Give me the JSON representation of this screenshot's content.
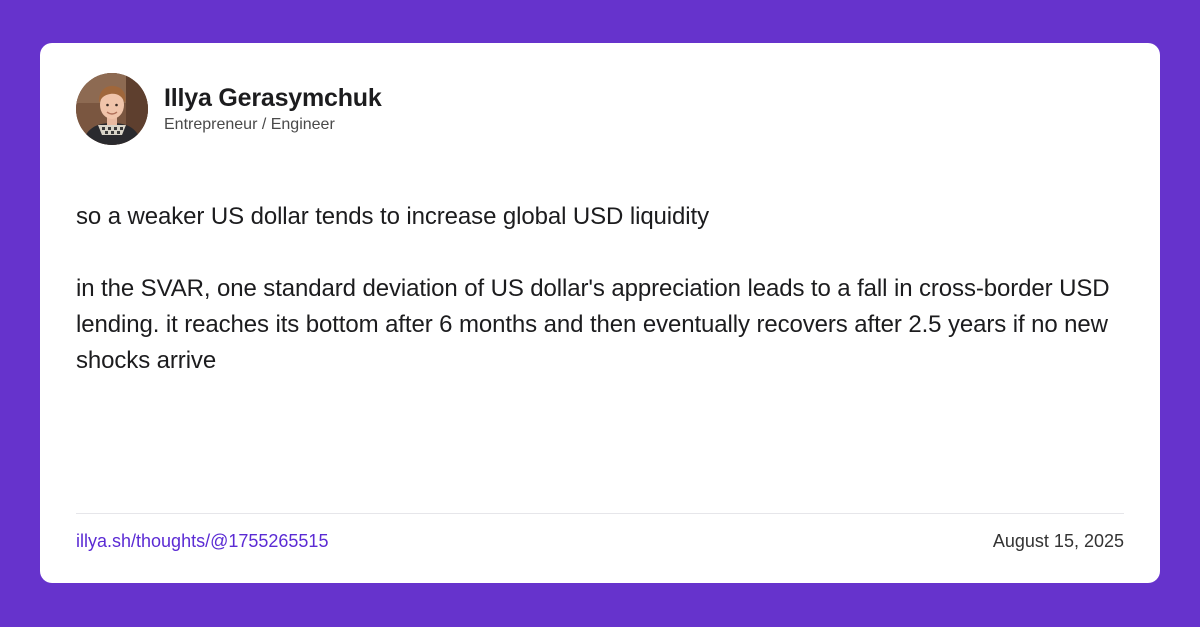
{
  "author": {
    "name": "Illya Gerasymchuk",
    "role": "Entrepreneur / Engineer"
  },
  "post": {
    "paragraphs": [
      "so a weaker US dollar tends to increase global USD liquidity",
      "in the SVAR, one standard deviation of US dollar's appreciation leads to a fall in cross-border USD lending. it reaches its bottom after 6 months and then eventually recovers after 2.5 years if no new shocks arrive"
    ]
  },
  "footer": {
    "link_text": "illya.sh/thoughts/@1755265515",
    "date": "August 15, 2025"
  },
  "colors": {
    "background": "#6633cc",
    "card": "#ffffff",
    "link": "#5b2bd4"
  },
  "icons": {
    "avatar": "author-avatar-photo"
  }
}
